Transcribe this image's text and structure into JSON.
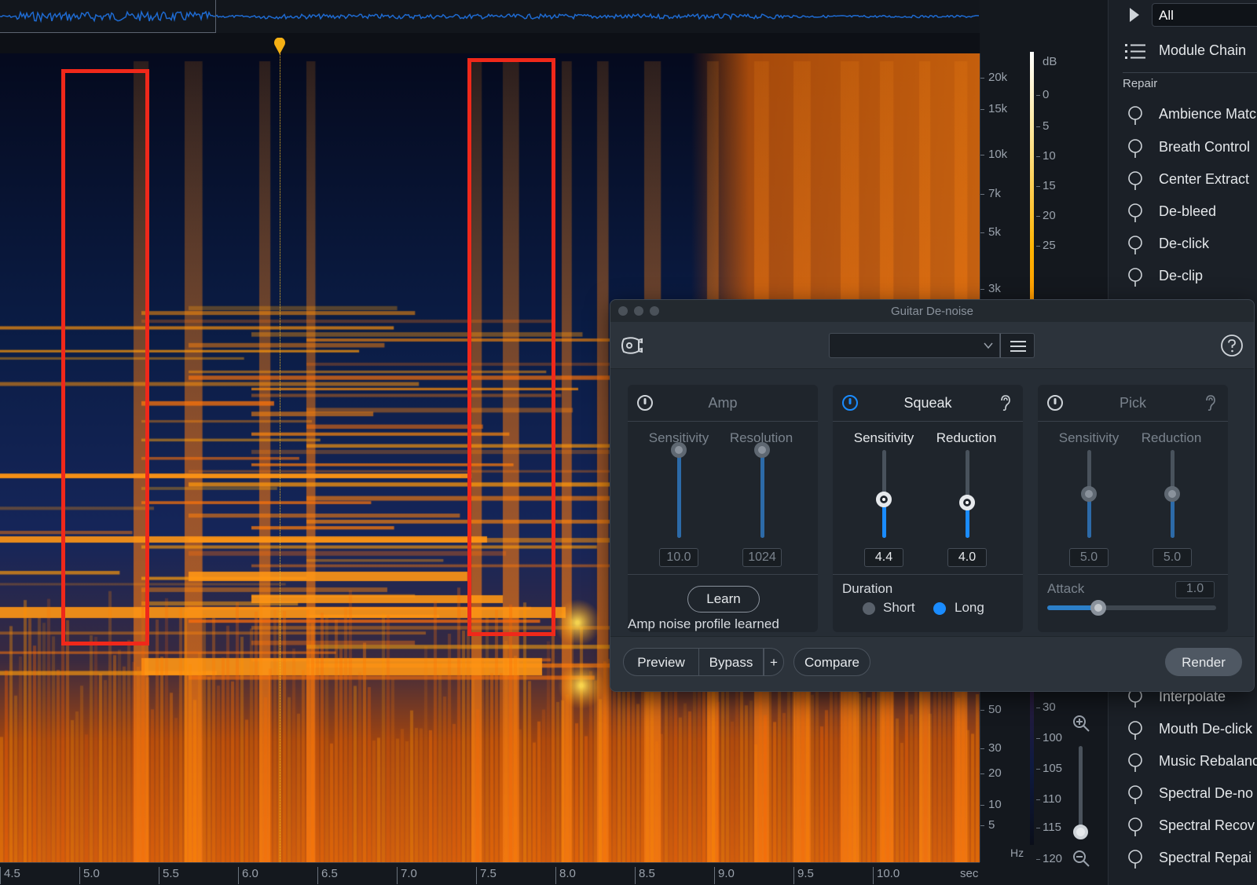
{
  "plugin": {
    "title": "Guitar De-noise",
    "status": "Amp noise profile learned",
    "preset_value": "",
    "panels": {
      "amp": {
        "title": "Amp",
        "enabled": false,
        "sliders": [
          {
            "label": "Sensitivity",
            "value": "10.0",
            "level": 1.0
          },
          {
            "label": "Resolution",
            "value": "1024",
            "level": 1.0
          }
        ],
        "learn_label": "Learn"
      },
      "squeak": {
        "title": "Squeak",
        "enabled": true,
        "sliders": [
          {
            "label": "Sensitivity",
            "value": "4.4",
            "level": 0.44
          },
          {
            "label": "Reduction",
            "value": "4.0",
            "level": 0.4
          }
        ],
        "duration_label": "Duration",
        "duration_options": [
          "Short",
          "Long"
        ],
        "duration_selected": "Long"
      },
      "pick": {
        "title": "Pick",
        "enabled": false,
        "sliders": [
          {
            "label": "Sensitivity",
            "value": "5.0",
            "level": 0.5
          },
          {
            "label": "Reduction",
            "value": "5.0",
            "level": 0.5
          }
        ],
        "attack_label": "Attack",
        "attack_value": "1.0",
        "attack_level": 0.3
      }
    },
    "footer": {
      "preview": "Preview",
      "bypass": "Bypass",
      "plus": "+",
      "compare": "Compare",
      "render": "Render"
    }
  },
  "sidebar": {
    "filter_value": "All",
    "module_chain": "Module Chain",
    "section": "Repair",
    "items": [
      {
        "label": "Ambience Matc",
        "icon": "ambience-match-icon"
      },
      {
        "label": "Breath Control",
        "icon": "breath-control-icon"
      },
      {
        "label": "Center Extract",
        "icon": "center-extract-icon"
      },
      {
        "label": "De-bleed",
        "icon": "de-bleed-icon"
      },
      {
        "label": "De-click",
        "icon": "de-click-icon"
      },
      {
        "label": "De-clip",
        "icon": "de-clip-icon"
      },
      {
        "label": "Interpolate",
        "icon": "interpolate-icon"
      },
      {
        "label": "Mouth De-click",
        "icon": "mouth-de-click-icon"
      },
      {
        "label": "Music Rebalanc",
        "icon": "music-rebalance-icon"
      },
      {
        "label": "Spectral De-no",
        "icon": "spectral-de-noise-icon"
      },
      {
        "label": "Spectral Recov",
        "icon": "spectral-recovery-icon"
      },
      {
        "label": "Spectral Repai",
        "icon": "spectral-repair-icon"
      }
    ]
  },
  "axes": {
    "freq_labels": [
      "20k",
      "15k",
      "10k",
      "7k",
      "5k",
      "3k",
      "50",
      "30",
      "20",
      "10",
      "5"
    ],
    "freq_unit": "Hz",
    "db_unit": "dB",
    "db_labels": [
      "0",
      "5",
      "10",
      "15",
      "20",
      "25",
      "30",
      "100",
      "105",
      "110",
      "115",
      "120"
    ],
    "time_labels": [
      "4.5",
      "5.0",
      "5.5",
      "6.0",
      "6.5",
      "7.0",
      "7.5",
      "8.0",
      "8.5",
      "9.0",
      "9.5",
      "10.0"
    ],
    "time_unit": "sec"
  },
  "colors": {
    "accent_blue": "#1a8cff",
    "selection_red": "#f0281a",
    "playhead_yellow": "#f5b014",
    "spectrogram_hot": "#ff8a00"
  }
}
